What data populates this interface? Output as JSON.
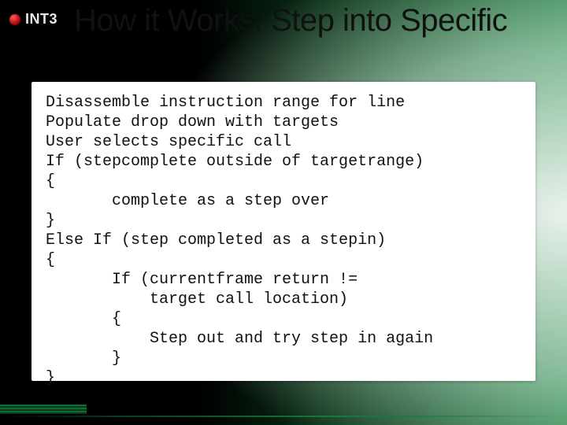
{
  "brand": {
    "name": "INT3"
  },
  "title": "How it Works: Step into Specific",
  "code": {
    "lines": [
      "Disassemble instruction range for line",
      "Populate drop down with targets",
      "User selects specific call",
      "If (stepcomplete outside of targetrange)",
      "{",
      "       complete as a step over",
      "}",
      "Else If (step completed as a stepin)",
      "{",
      "       If (currentframe return !=",
      "           target call location)",
      "       {",
      "           Step out and try step in again",
      "       }",
      "}"
    ]
  }
}
